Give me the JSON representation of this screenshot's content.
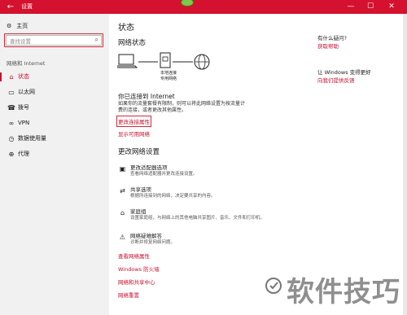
{
  "window": {
    "title": "设置",
    "back": "←",
    "min": "—",
    "max": "☐",
    "close": "✕"
  },
  "sidebar": {
    "home": "主页",
    "search_placeholder": "查找设置",
    "section": "网络和 Internet",
    "items": [
      {
        "label": "状态",
        "icon": "home-globe-icon",
        "active": true
      },
      {
        "label": "以太网",
        "icon": "ethernet-icon"
      },
      {
        "label": "拨号",
        "icon": "phone-icon"
      },
      {
        "label": "VPN",
        "icon": "vpn-icon"
      },
      {
        "label": "数据使用量",
        "icon": "clock-icon"
      },
      {
        "label": "代理",
        "icon": "globe-icon"
      }
    ]
  },
  "main": {
    "title": "状态",
    "network_status_heading": "网络状态",
    "diagram_label_line1": "本地连接",
    "diagram_label_line2": "专用网络",
    "connected_title": "你已连接到 Internet",
    "connected_desc_line1": "如果你的流量套餐有限制，则可以将此网络设置为按流量计",
    "connected_desc_line2": "费的连接，或者更改其他属性。",
    "change_props_link": "更改连接属性",
    "show_networks_link": "显示可用网络",
    "change_settings_heading": "更改网络设置",
    "options": [
      {
        "title": "更改适配器选项",
        "desc": "查看网络适配器并更改连接设置。",
        "icon": "adapter-icon"
      },
      {
        "title": "共享选项",
        "desc": "根据所连接到的网络，决定要共享的内容。",
        "icon": "share-icon"
      },
      {
        "title": "家庭组",
        "desc": "设置家庭组，与网络上的其他电脑共享图片、音乐、文件和打印机。",
        "icon": "homegroup-icon"
      },
      {
        "title": "网络疑难解答",
        "desc": "诊断并修复网络问题。",
        "icon": "warning-icon"
      }
    ],
    "links": [
      "查看网络属性",
      "Windows 防火墙",
      "网络和共享中心",
      "网络重置"
    ]
  },
  "right": {
    "q1": "有什么疑问?",
    "a1": "获取帮助",
    "q2": "让 Windows 变得更好",
    "a2": "向我们提供反馈"
  },
  "watermark": "软件技巧"
}
